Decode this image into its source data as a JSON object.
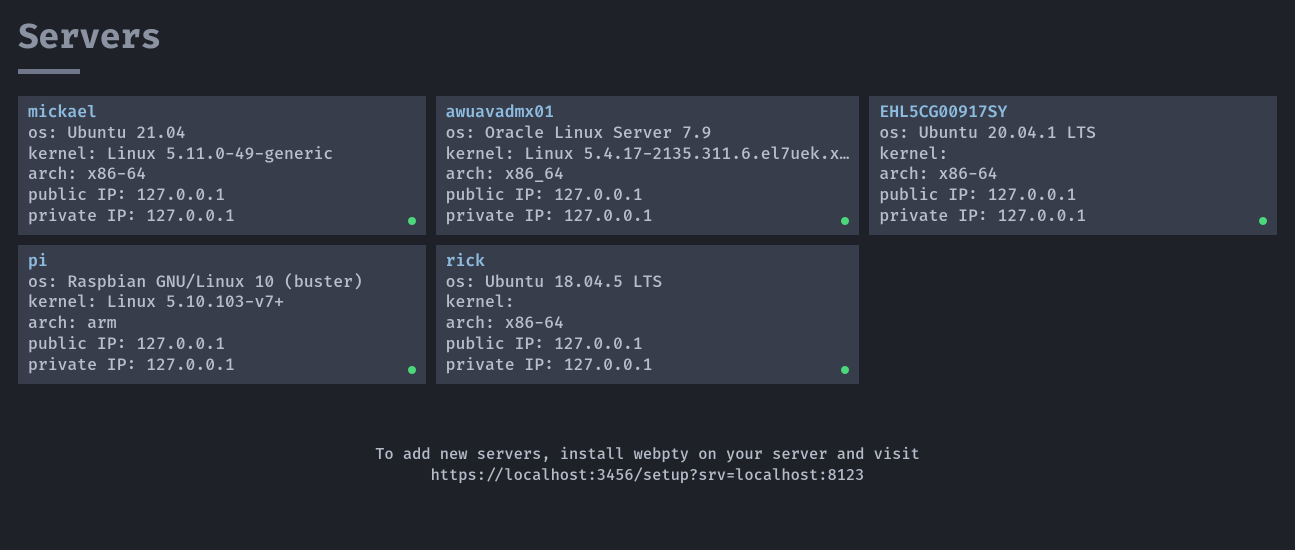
{
  "title": "Servers",
  "servers": [
    {
      "name": "mickael",
      "os": "Ubuntu 21.04",
      "kernel": "Linux 5.11.0-49-generic",
      "arch": "x86-64",
      "public_ip": "127.0.0.1",
      "private_ip": "127.0.0.1",
      "status": "online"
    },
    {
      "name": "awuavadmx01",
      "os": "Oracle Linux Server 7.9",
      "kernel": "Linux 5.4.17-2135.311.6.el7uek.x…",
      "arch": "x86_64",
      "public_ip": "127.0.0.1",
      "private_ip": "127.0.0.1",
      "status": "online"
    },
    {
      "name": "EHL5CG00917SY",
      "os": "Ubuntu 20.04.1 LTS",
      "kernel": "",
      "arch": "x86-64",
      "public_ip": "127.0.0.1",
      "private_ip": "127.0.0.1",
      "status": "online"
    },
    {
      "name": "pi",
      "os": "Raspbian GNU/Linux 10 (buster)",
      "kernel": "Linux 5.10.103-v7+",
      "arch": "arm",
      "public_ip": "127.0.0.1",
      "private_ip": "127.0.0.1",
      "status": "online"
    },
    {
      "name": "rick",
      "os": "Ubuntu 18.04.5 LTS",
      "kernel": "",
      "arch": "x86-64",
      "public_ip": "127.0.0.1",
      "private_ip": "127.0.0.1",
      "status": "online"
    }
  ],
  "labels": {
    "os": "os: ",
    "kernel": "kernel: ",
    "arch": "arch: ",
    "public_ip": "public IP: ",
    "private_ip": "private IP: "
  },
  "footer": {
    "line1": "To add new servers, install webpty on your server and visit",
    "line2": "https://localhost:3456/setup?srv=localhost:8123"
  },
  "colors": {
    "background": "#1e2128",
    "card": "#373d4a",
    "text": "#b5bcc9",
    "name": "#8dbce0",
    "status_online": "#4cd77b"
  }
}
